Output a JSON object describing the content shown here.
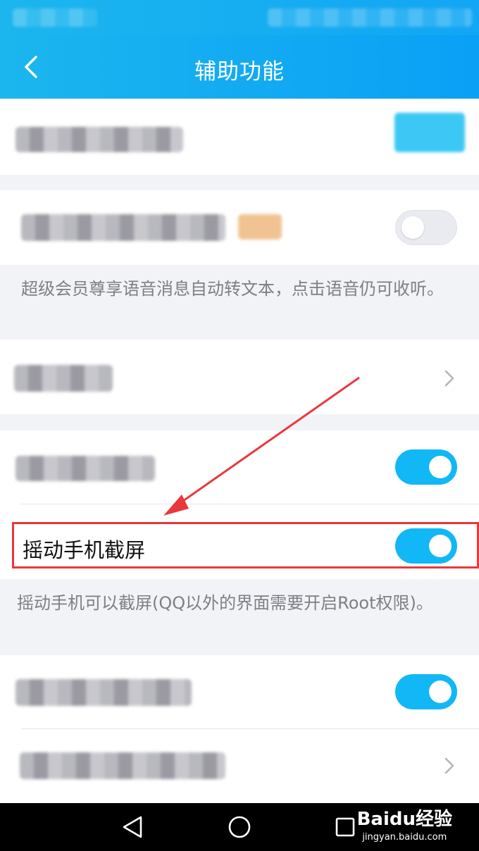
{
  "header": {
    "title": "辅助功能"
  },
  "rows": {
    "shake_screenshot": {
      "label": "摇动手机截屏",
      "toggle_on": true
    }
  },
  "notes": {
    "voice_to_text": "超级会员尊享语音消息自动转文本，点击语音仍可收听。",
    "shake_desc": "摇动手机可以截屏(QQ以外的界面需要开启Root权限)。"
  },
  "watermark": {
    "logo": "Baidu经验",
    "url": "jingyan.baidu.com"
  },
  "colors": {
    "accent": "#12b7f5",
    "highlight": "#e8383d",
    "header_start": "#1bb6ee",
    "header_end": "#0aa0f6"
  },
  "icons": [
    "back-chevron-icon",
    "chevron-right-icon",
    "nav-back-icon",
    "nav-home-icon",
    "nav-recents-icon"
  ]
}
